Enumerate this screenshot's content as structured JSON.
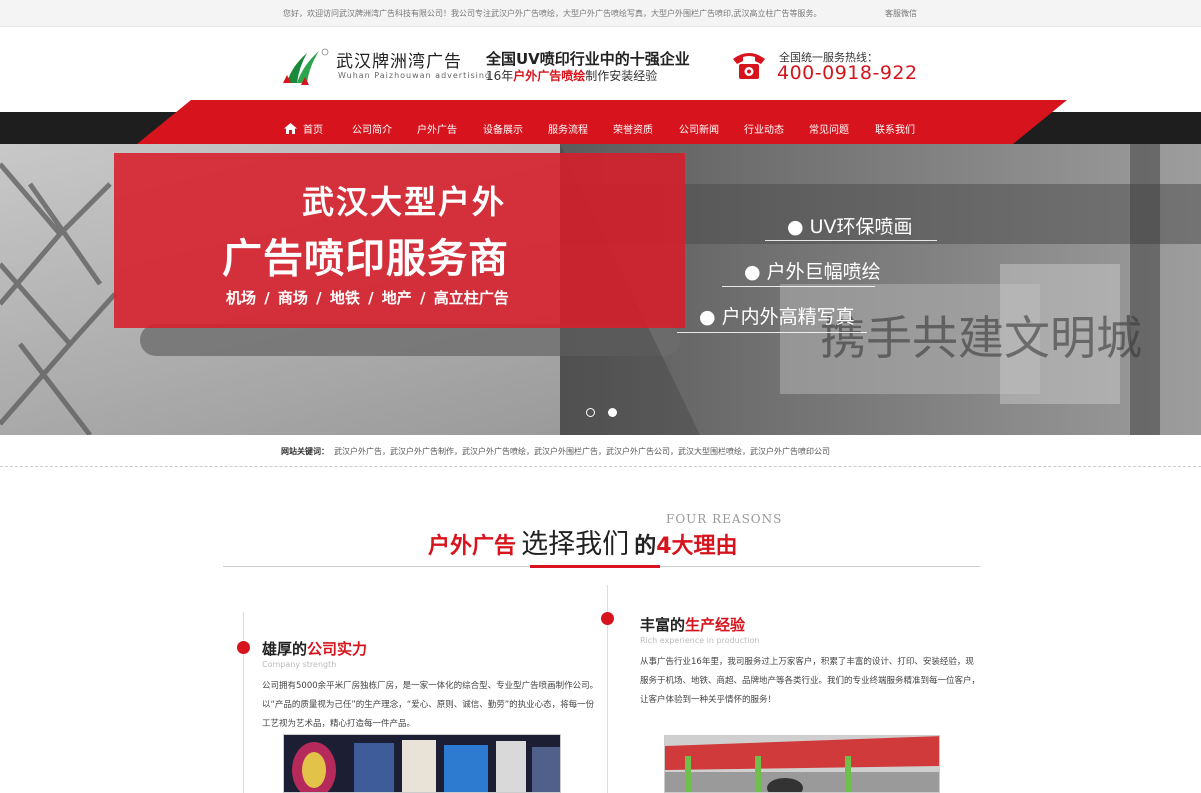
{
  "topbar": {
    "welcome": "您好，欢迎访问武汉牌洲湾广告科技有限公司！我公司专注武汉户外广告喷绘，大型户外广告喷绘写真，大型户外围栏广告喷印,武汉高立柱广告等服务。",
    "service": "客服微信"
  },
  "header": {
    "logo_cn": "武汉牌洲湾广告",
    "logo_en": "Wuhan Paizhouwan advertising",
    "slogan_line1": "全国UV喷印行业中的十强企业",
    "slogan_line2_a": "16年",
    "slogan_line2_b": "户外广告喷绘",
    "slogan_line2_c": "制作安装经验",
    "hotline_label": "全国统一服务热线：",
    "hotline_number": "400-0918-922"
  },
  "nav": {
    "items": [
      "首页",
      "公司简介",
      "户外广告",
      "设备展示",
      "服务流程",
      "荣誉资质",
      "公司新闻",
      "行业动态",
      "常见问题",
      "联系我们"
    ]
  },
  "banner": {
    "headline1": "武汉大型户外",
    "headline2": "广告喷印服务商",
    "places": "机场 /  商场 /  地铁 /  地产 /  高立柱广告",
    "bullets": [
      "UV环保喷画",
      "户外巨幅喷绘",
      "户内外高精写真"
    ],
    "slides": 2,
    "active_slide": 1
  },
  "keywords": {
    "label": "网站关键词：",
    "text": "武汉户外广告，武汉户外广告制作，武汉户外广告喷绘，武汉户外围栏广告，武汉户外广告公司，武汉大型围栏喷绘，武汉户外广告喷印公司"
  },
  "section": {
    "en": "FOUR REASONS",
    "t1": "户外广告",
    "t2": "选择我们",
    "t3": "的",
    "t4": "4大理由"
  },
  "reasons": [
    {
      "title_a": "雄厚的",
      "title_b": "公司实力",
      "en": "Company strength",
      "text": "公司拥有5000余平米厂房独栋厂房，是一家一体化的综合型、专业型广告喷画制作公司。以“产品的质量视为己任”的生产理念，“爱心、原则、诚信、勤劳”的执业心态，将每一份工艺视为艺术品，精心打造每一件产品。"
    },
    {
      "title_a": "丰富的",
      "title_b": "生产经验",
      "en": "Rich experience in production",
      "text": "从事广告行业16年里，我司服务过上万家客户，积累了丰富的设计、打印、安装经验，现服务于机场、地铁、商超、品牌地产等各类行业。我们的专业终端服务精准到每一位客户，让客户体验到一种关乎情怀的服务！"
    }
  ],
  "colors": {
    "brand_red": "#d7141d",
    "nav_dark": "#1e1e1e"
  }
}
